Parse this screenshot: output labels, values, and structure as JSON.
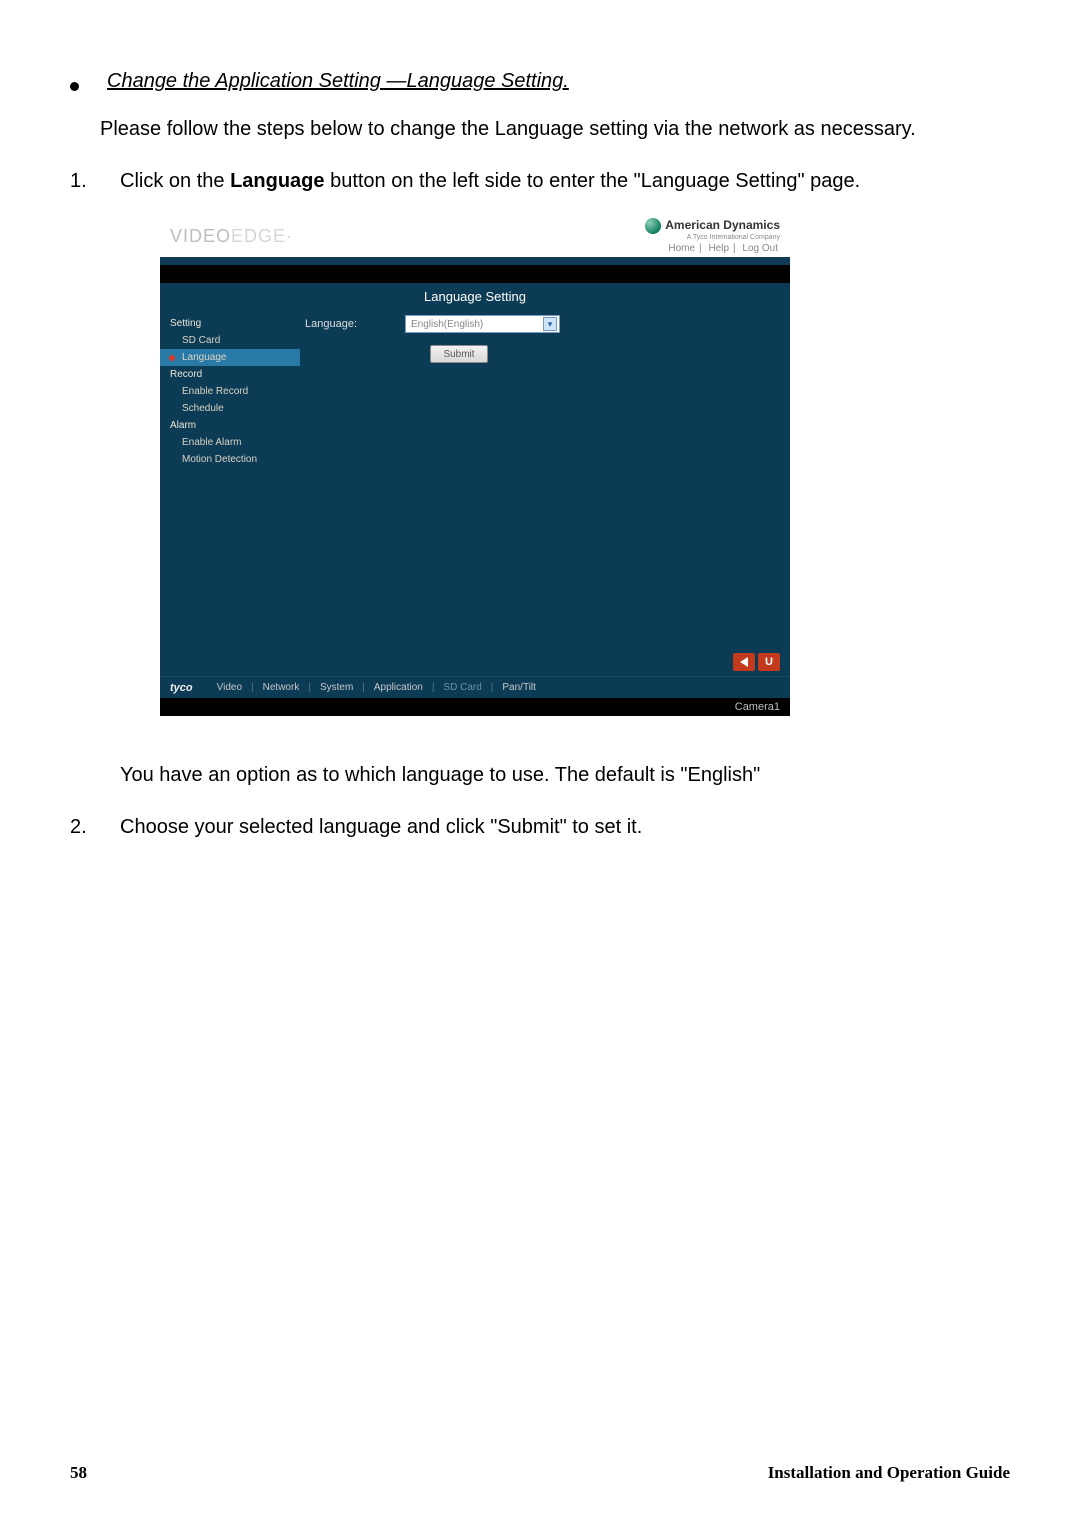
{
  "doc": {
    "heading": "Change the Application Setting —Language Setting.",
    "para1": "Please follow the steps below to change the Language setting via the network as necessary.",
    "step1_num": "1.",
    "step1_pre": "Click on the ",
    "step1_bold": "Language",
    "step1_post": " button on the left side to enter the \"Language Setting\" page.",
    "para2": "You have an option as to which language to use. The default is \"English\"",
    "step2_num": "2.",
    "step2_txt": "Choose your selected language and click \"Submit\" to set it.",
    "page_num": "58",
    "page_title": "Installation and Operation Guide"
  },
  "ui": {
    "logo_left": "VIDEO",
    "logo_right": "EDGE",
    "brand_name": "American Dynamics",
    "brand_sub": "A Tyco International Company",
    "top_links": {
      "home": "Home",
      "help": "Help",
      "logout": "Log Out"
    },
    "title": "Language Setting",
    "sidebar": {
      "g1": "Setting",
      "i1": "SD Card",
      "i2": "Language",
      "g2": "Record",
      "i3": "Enable Record",
      "i4": "Schedule",
      "g3": "Alarm",
      "i5": "Enable Alarm",
      "i6": "Motion Detection"
    },
    "form": {
      "lang_label": "Language:",
      "lang_value": "English(English)",
      "submit": "Submit"
    },
    "u_label": "U",
    "footer": {
      "tyco": "tyco",
      "video": "Video",
      "network": "Network",
      "system": "System",
      "app": "Application",
      "sd": "SD Card",
      "pan": "Pan/Tilt",
      "cam": "Camera1"
    }
  }
}
